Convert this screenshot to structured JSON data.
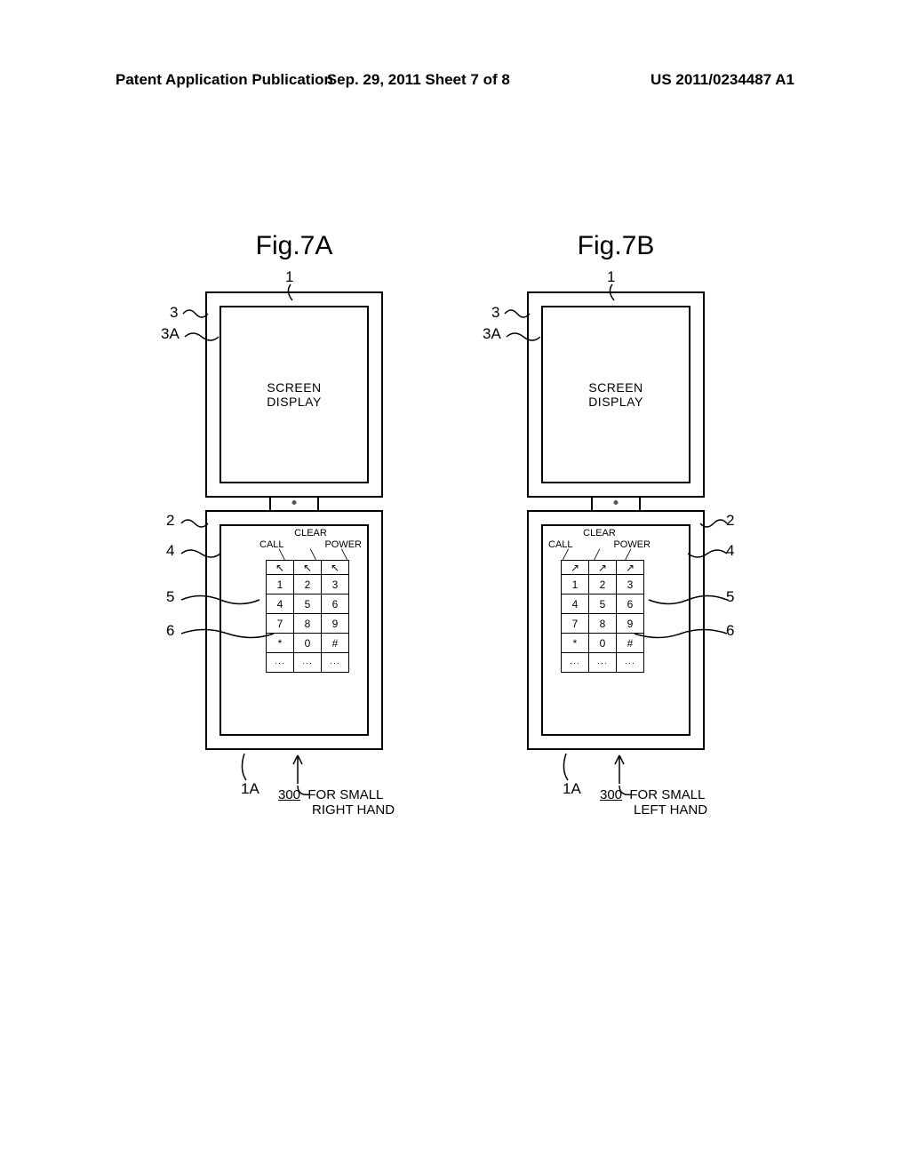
{
  "header": {
    "left": "Patent Application Publication",
    "center": "Sep. 29, 2011  Sheet 7 of 8",
    "right": "US 2011/0234487 A1"
  },
  "figA": {
    "title": "Fig.7A",
    "screen_l1": "SCREEN",
    "screen_l2": "DISPLAY",
    "labels": {
      "call": "CALL",
      "clear": "CLEAR",
      "power": "POWER"
    },
    "refs": {
      "r1": "1",
      "r3": "3",
      "r3A": "3A",
      "r2": "2",
      "r4": "4",
      "r5": "5",
      "r6": "6",
      "r1A": "1A"
    },
    "caption_num": "300",
    "caption_l1": "FOR SMALL",
    "caption_l2": "RIGHT HAND"
  },
  "figB": {
    "title": "Fig.7B",
    "screen_l1": "SCREEN",
    "screen_l2": "DISPLAY",
    "labels": {
      "call": "CALL",
      "clear": "CLEAR",
      "power": "POWER"
    },
    "refs": {
      "r1": "1",
      "r3": "3",
      "r3A": "3A",
      "r2": "2",
      "r4": "4",
      "r5": "5",
      "r6": "6",
      "r1A": "1A"
    },
    "caption_num": "300",
    "caption_l1": "FOR SMALL",
    "caption_l2": "LEFT HAND"
  },
  "keys": {
    "row1": [
      "1",
      "2",
      "3"
    ],
    "row2": [
      "4",
      "5",
      "6"
    ],
    "row3": [
      "7",
      "8",
      "9"
    ],
    "row4": [
      "*",
      "0",
      "#"
    ],
    "row5": [
      "···",
      "···",
      "···"
    ]
  },
  "func_leads": {
    "down": "⬊",
    "up": "⬈"
  }
}
